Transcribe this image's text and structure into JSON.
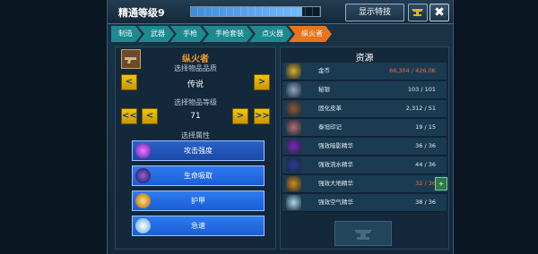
{
  "topbar": {
    "mastery_label": "精通等级9",
    "xp_progress": 0.86,
    "special_button": "显示特技",
    "close_symbol": "✖"
  },
  "breadcrumbs": [
    "制造",
    "武器",
    "手枪",
    "手枪套装",
    "点火器",
    "纵火者"
  ],
  "item": {
    "name": "纵火者",
    "quality_label": "选择物品品质",
    "quality_value": "传说",
    "level_label": "选择物品等级",
    "level_value": "71",
    "attr_label": "选择属性"
  },
  "nav": {
    "prev": "<",
    "next": ">",
    "first": "<<",
    "last": ">>"
  },
  "attributes": [
    {
      "label": "攻击强度",
      "color": "#9a38d6"
    },
    {
      "label": "生命吸取",
      "color": "#3a2a8a"
    },
    {
      "label": "护甲",
      "color": "#d88a1a"
    },
    {
      "label": "急速",
      "color": "#a8d8f0"
    }
  ],
  "resources": {
    "title": "资源",
    "items": [
      {
        "name": "金币",
        "value": "66,304 / 426.0K",
        "warn": true,
        "color": "#d8b028",
        "icon": "gold-coins-icon"
      },
      {
        "name": "秘银",
        "value": "103 / 101",
        "warn": false,
        "color": "#8fa8c0",
        "icon": "mithril-icon"
      },
      {
        "name": "固化皮革",
        "value": "2,312 / 51",
        "warn": false,
        "color": "#8a5a34",
        "icon": "leather-icon"
      },
      {
        "name": "泰坦印记",
        "value": "19 / 15",
        "warn": false,
        "color": "#b07070",
        "icon": "titan-mark-icon"
      },
      {
        "name": "强效暗影精华",
        "value": "36 / 36",
        "warn": false,
        "color": "#7a28b8",
        "icon": "shadow-essence-icon"
      },
      {
        "name": "强效流水精华",
        "value": "44 / 36",
        "warn": false,
        "color": "#2a3a9a",
        "icon": "water-essence-icon"
      },
      {
        "name": "强效大地精华",
        "value": "32 / 36",
        "warn": true,
        "color": "#d88a1a",
        "icon": "earth-essence-icon",
        "plus": "+"
      },
      {
        "name": "强效空气精华",
        "value": "38 / 36",
        "warn": false,
        "color": "#a8d8f0",
        "icon": "air-essence-icon"
      }
    ]
  }
}
